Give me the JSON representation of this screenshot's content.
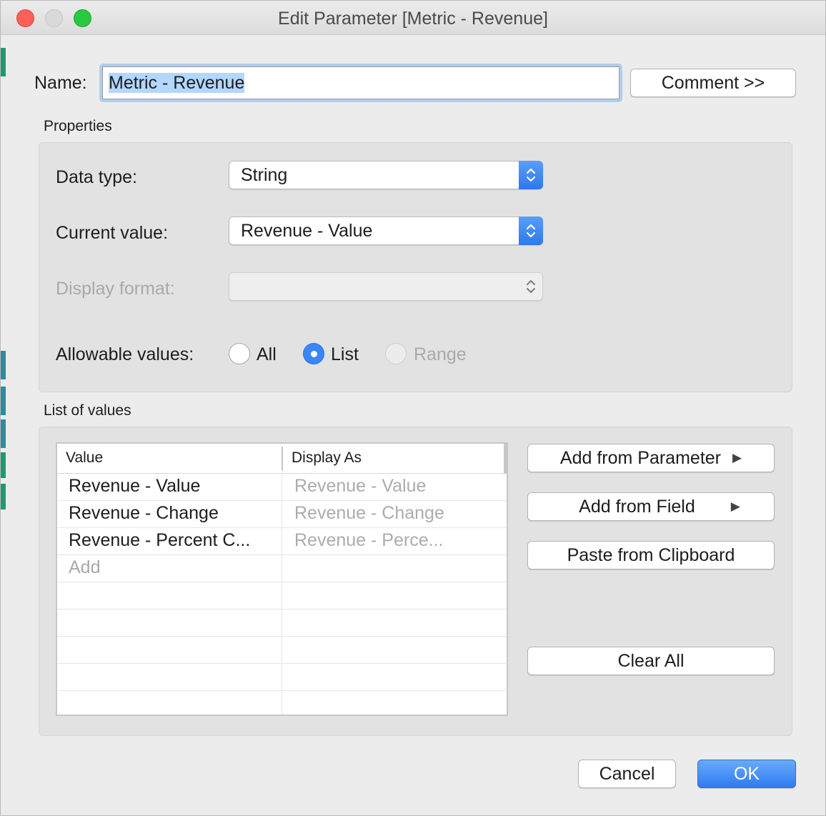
{
  "window": {
    "title": "Edit Parameter [Metric - Revenue]"
  },
  "name": {
    "label": "Name:",
    "value": "Metric - Revenue",
    "comment_button": "Comment >>"
  },
  "properties": {
    "section_label": "Properties",
    "data_type": {
      "label": "Data type:",
      "value": "String"
    },
    "current_value": {
      "label": "Current value:",
      "value": "Revenue - Value"
    },
    "display_format": {
      "label": "Display format:",
      "value": ""
    },
    "allowable_values": {
      "label": "Allowable values:",
      "options": [
        {
          "label": "All",
          "selected": false,
          "enabled": true
        },
        {
          "label": "List",
          "selected": true,
          "enabled": true
        },
        {
          "label": "Range",
          "selected": false,
          "enabled": false
        }
      ]
    }
  },
  "list": {
    "section_label": "List of values",
    "columns": [
      "Value",
      "Display As"
    ],
    "rows": [
      {
        "value": "Revenue - Value",
        "display": "Revenue - Value"
      },
      {
        "value": "Revenue - Change",
        "display": "Revenue - Change"
      },
      {
        "value": "Revenue - Percent C...",
        "display": "Revenue - Perce..."
      }
    ],
    "add_placeholder": "Add",
    "buttons": {
      "add_from_parameter": "Add from Parameter",
      "add_from_field": "Add from Field",
      "paste_from_clipboard": "Paste from Clipboard",
      "clear_all": "Clear All"
    }
  },
  "footer": {
    "cancel": "Cancel",
    "ok": "OK"
  },
  "colors": {
    "accent": "#3b86f6",
    "close": "#fe5f57",
    "maximize": "#28c840"
  }
}
